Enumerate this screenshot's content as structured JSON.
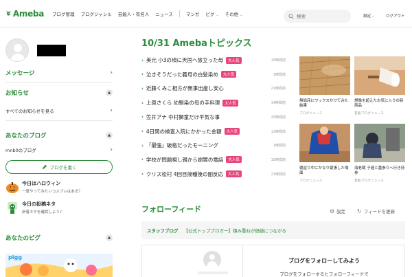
{
  "header": {
    "logo_text": "Ameba",
    "nav": [
      {
        "label": "ブログ管理",
        "name": "nav-blog-manage"
      },
      {
        "label": "ブログジャンル",
        "name": "nav-blog-genre"
      },
      {
        "label": "芸能人・有名人",
        "name": "nav-celebrities"
      },
      {
        "label": "ニュース",
        "name": "nav-news"
      }
    ],
    "nav2": [
      {
        "label": "マンガ",
        "name": "nav-manga",
        "chevron": false
      },
      {
        "label": "ピグ",
        "name": "nav-pigg",
        "chevron": true
      },
      {
        "label": "その他",
        "name": "nav-other",
        "chevron": true
      }
    ],
    "search_placeholder": "検索",
    "settings_label": "設定",
    "logout_label": "ログアウト",
    "chevron": "⌄"
  },
  "left": {
    "message_label": "メッセージ",
    "notice_label": "お知らせ",
    "all_notices_label": "すべてのお知らせを見る",
    "your_blog_label": "あなたのブログ",
    "blog_name": "mnb0のブログ",
    "write_button_label": "ブログを書く",
    "tips": [
      {
        "title": "今日はハロウィン",
        "sub": "一度やってみたいコスプレはある？"
      },
      {
        "title": "今日の投稿ネタ",
        "sub": "新着ネタを確認しよう♪"
      }
    ],
    "your_pigg_label": "あなたのピグ",
    "banner_text": "pigg"
  },
  "topics": {
    "title": "10/31 Amebaトピックス",
    "items": [
      {
        "title": "美元 小3の頃に天国へ旅立った母",
        "badge": "大人気",
        "views": "10時間前"
      },
      {
        "title": "泣きそうだった義母の白髪染め",
        "badge": "大人気",
        "views": "1時間前"
      },
      {
        "title": "近藤くみこ相方が無事出産し安心",
        "badge": "",
        "views": "21時間前"
      },
      {
        "title": "上原さくら 幼馴染の母の手料理",
        "badge": "大人気",
        "views": "14時間前"
      },
      {
        "title": "笠井アナ 中村獅童だけ平気な事",
        "badge": "",
        "views": "20時間前"
      },
      {
        "title": "4日間の検査入院にかかった金額",
        "badge": "大人気",
        "views": "12時間前"
      },
      {
        "title": "「最強」破格だったモーニング",
        "badge": "",
        "views": "1時間前"
      },
      {
        "title": "学校が問題視し親から謝罪の電話",
        "badge": "大人気",
        "views": "15時間前"
      },
      {
        "title": "クリス松村 4回目接種後の副反応",
        "badge": "大人気",
        "views": "21時間前"
      }
    ],
    "arrow": "›"
  },
  "thumbs": [
    {
      "caption": "無垢床にワックスかけてみた結果",
      "source": "ブログニュース"
    },
    {
      "caption": "想像を超えたお気に入りの新商品",
      "source": "芸能ブログニュース"
    },
    {
      "caption": "寝返り中にかなり緊張した場面",
      "source": "ブログニュース"
    },
    {
      "caption": "海老蔵 子連と墓参りへ行き持参",
      "source": "芸能ブログニュース"
    }
  ],
  "feed": {
    "title": "フォローフィード",
    "settings_label": "設定",
    "refresh_label": "フィードを更新",
    "staff_label": "スタッフブログ",
    "staff_text": "【公式トップブロガー】積み重ねが価値につながる",
    "follow_title": "ブログをフォローしてみよう",
    "follow_sub": "ブログをフォローするとフォローフィードで"
  },
  "colors": {
    "brand_green": "#2d8c3c",
    "badge_pink": "#e8457a"
  }
}
